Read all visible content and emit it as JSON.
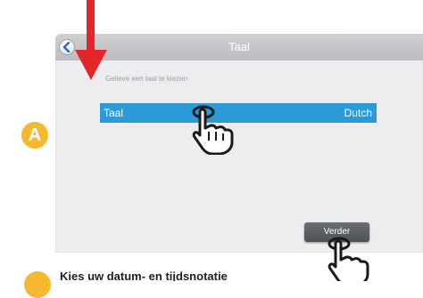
{
  "screen": {
    "title": "Taal",
    "prompt": "Gelieve een taal te kiezen",
    "language_row": {
      "label": "Taal",
      "value": "Dutch"
    },
    "continue_label": "Verder"
  },
  "annotations": {
    "step_badge": "A",
    "bottom_caption": "Kies uw datum- en tijdsnotatie"
  },
  "colors": {
    "highlight": "#2a9ad8",
    "arrow": "#e3262b",
    "badge": "#f5b82e"
  },
  "icons": [
    "chevron-left-icon",
    "pointing-hand-icon",
    "down-arrow-icon"
  ]
}
